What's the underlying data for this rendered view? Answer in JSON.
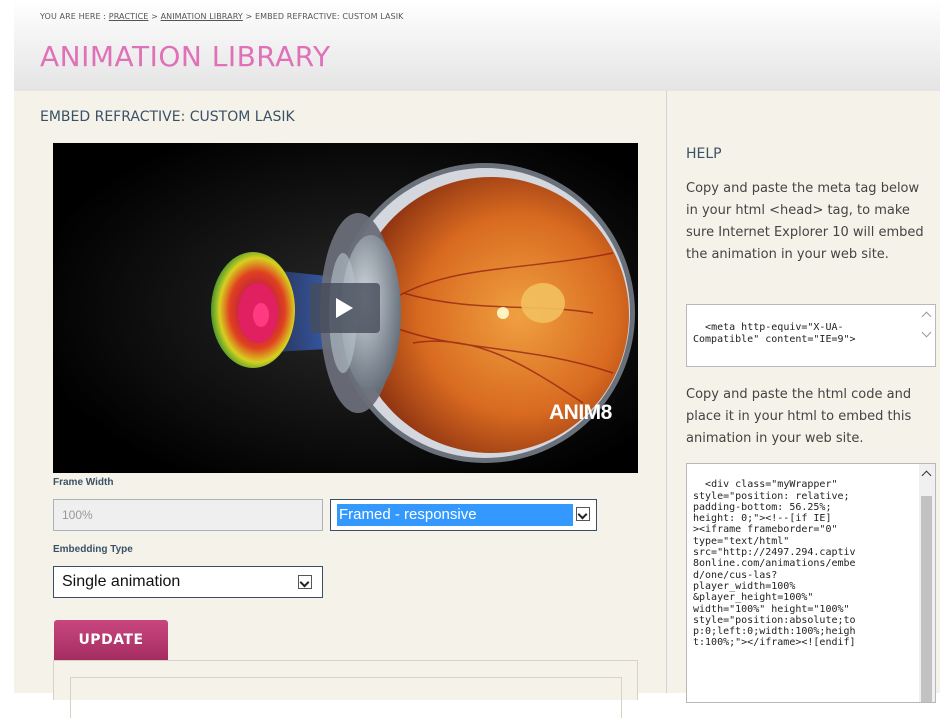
{
  "breadcrumb": {
    "prefix": "YOU ARE HERE :",
    "practice": "PRACTICE",
    "sep1": ">",
    "library": "ANIMATION LIBRARY",
    "sep2": ">",
    "current": "EMBED REFRACTIVE: CUSTOM LASIK"
  },
  "page_title": "ANIMATION LIBRARY",
  "main": {
    "section_title": "EMBED REFRACTIVE: CUSTOM LASIK",
    "video_watermark": "ANIM8",
    "frame_width_label": "Frame Width",
    "frame_width_value": "100%",
    "frame_type_selected": "Framed - responsive",
    "embedding_type_label": "Embedding Type",
    "embedding_type_selected": "Single animation",
    "update_label": "UPDATE"
  },
  "help": {
    "title": "HELP",
    "text1": "Copy and paste the meta tag below in your html <head> tag, to make sure Internet Explorer 10 will embed the animation in your web site.",
    "meta_code": "<meta http-equiv=\"X-UA-\nCompatible\" content=\"IE=9\">",
    "text2": "Copy and paste the html code and place it in your html to embed this animation in your web site.",
    "embed_code": "<div class=\"myWrapper\"\nstyle=\"position: relative;\npadding-bottom: 56.25%;\nheight: 0;\"><!--[if IE]\n><iframe frameborder=\"0\"\ntype=\"text/html\"\nsrc=\"http://2497.294.captiv\n8online.com/animations/embe\nd/one/cus-las?\nplayer_width=100%\n&player_height=100%\"\nwidth=\"100%\" height=\"100%\"\nstyle=\"position:absolute;to\np:0;left:0;width:100%;heigh\nt:100%;\"></iframe><![endif]"
  },
  "colors": {
    "title_pink": "#e070b8",
    "update_button": "#b03468",
    "heading_blue": "#3a5266",
    "select_highlight": "#3399ff"
  }
}
